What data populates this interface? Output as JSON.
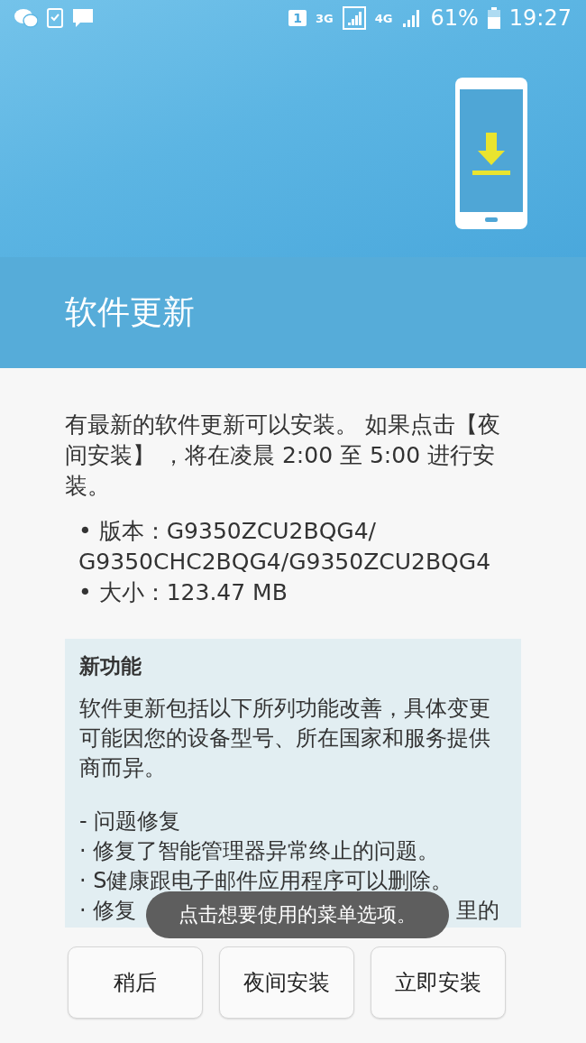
{
  "status_bar": {
    "sim": "1",
    "network_3g": "3G",
    "network_4g": "4G",
    "battery": "61%",
    "time": "19:27"
  },
  "header": {
    "title": "软件更新"
  },
  "intro": "有最新的软件更新可以安装。 如果点击【夜间安装】 ，将在凌晨 2:00 至 5:00 进行安装。",
  "details": [
    {
      "lines": [
        "• 版本：G9350ZCU2BQG4/",
        "G9350CHC2BQG4/G9350ZCU2BQG4"
      ]
    },
    {
      "lines": [
        "• 大小：123.47 MB"
      ]
    }
  ],
  "whats_new": {
    "title": "新功能",
    "description": "软件更新包括以下所列功能改善，具体变更可能因您的设备型号、所在国家和服务提供商而异。",
    "section": "- 问题修复",
    "items": [
      {
        "parts": [
          "· 修复了智能管理器异常终止的问题。"
        ]
      },
      {
        "parts": [
          "· S健康跟电子邮件应用程序可以删除。"
        ]
      },
      {
        "parts": [
          "· 修复",
          "里的"
        ]
      }
    ]
  },
  "toast": "点击想要使用的菜单选项。",
  "buttons": [
    "稍后",
    "夜间安装",
    "立即安装"
  ]
}
